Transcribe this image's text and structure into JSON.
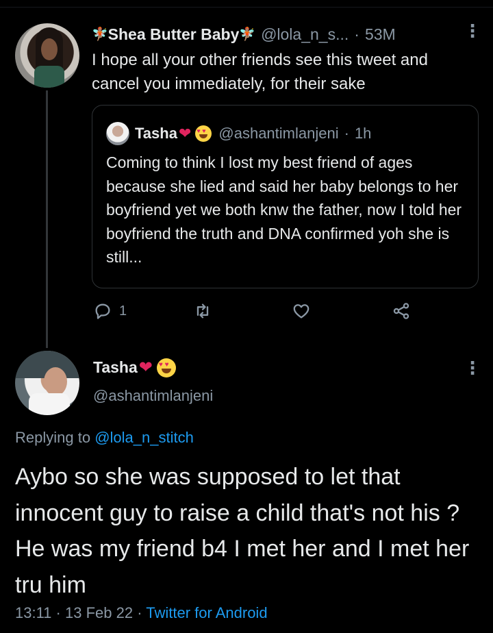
{
  "tweet_reply": {
    "name": "Shea Butter Baby",
    "name_emoji_left": "🧚🏽",
    "name_emoji_right": "🧚🏽",
    "handle": "@lola_n_s...",
    "separator": "·",
    "time": "53M",
    "text": "I hope all your other friends see this tweet and cancel you immediately, for their sake"
  },
  "quoted_tweet": {
    "name": "Tasha",
    "handle": "@ashantimlanjeni",
    "separator": "·",
    "time": "1h",
    "text": "Coming to think I lost my best friend of ages because she lied and said her baby belongs to her boyfriend yet we both knw the father, now I told her boyfriend the truth and DNA confirmed yoh she is still..."
  },
  "actions": {
    "reply_count": "1",
    "reply_icon": "reply-icon",
    "retweet_icon": "retweet-icon",
    "like_icon": "like-icon",
    "share_icon": "share-icon"
  },
  "main_tweet": {
    "name": "Tasha",
    "handle": "@ashantimlanjeni",
    "replying_prefix": "Replying to",
    "replying_to": "@lola_n_stitch",
    "text": "Aybo so she was supposed to let that innocent guy to raise a child that's not his ?  He was my friend b4 I met her and I met her tru him",
    "time": "13:11",
    "date": "13 Feb 22",
    "separator": "·",
    "source": "Twitter for Android"
  },
  "colors": {
    "background": "#000000",
    "text": "#e7e9ea",
    "secondary": "#8b98a5",
    "link": "#1d9bf0",
    "heart": "#e0245e"
  }
}
